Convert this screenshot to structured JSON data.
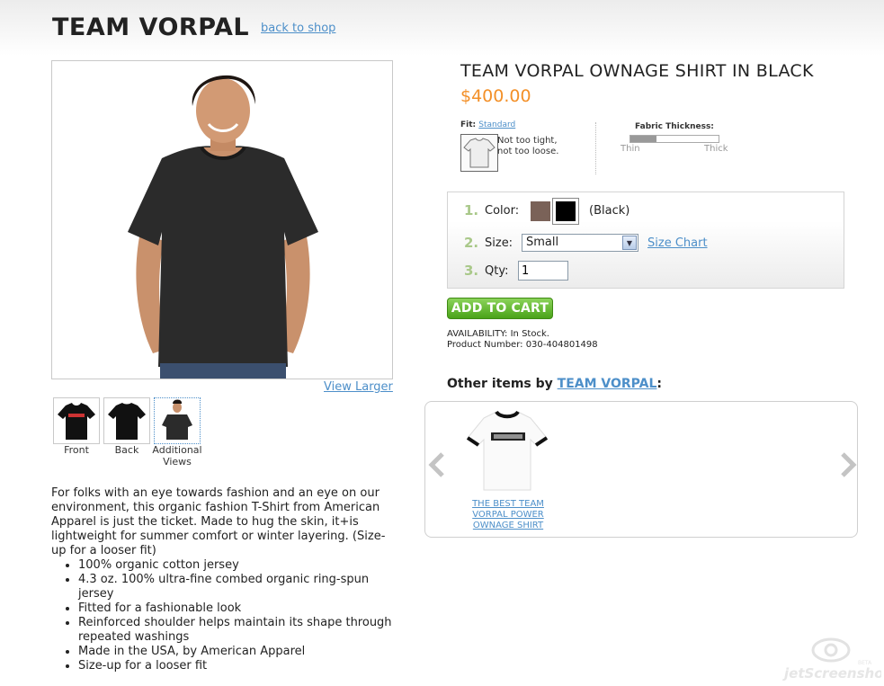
{
  "header": {
    "brand": "TEAM VORPAL",
    "back_link": "back to shop"
  },
  "gallery": {
    "view_larger": "View Larger",
    "thumbnails": [
      {
        "label": "Front"
      },
      {
        "label": "Back"
      },
      {
        "label": "Additional Views"
      }
    ]
  },
  "product": {
    "title": "TEAM VORPAL OWNAGE SHIRT IN BLACK",
    "price": "$400.00",
    "fit_label": "Fit:",
    "fit_value": "Standard",
    "fit_desc": "Not too tight, not too loose.",
    "thickness_label": "Fabric Thickness:",
    "thickness_level": 0.3,
    "thin_label": "Thin",
    "thick_label": "Thick"
  },
  "options": {
    "step1": "1.",
    "color_label": "Color:",
    "color_value": "(Black)",
    "swatches": [
      "#7a6258",
      "#000000"
    ],
    "step2": "2.",
    "size_label": "Size:",
    "size_selected": "Small",
    "size_chart": "Size Chart",
    "step3": "3.",
    "qty_label": "Qty:",
    "qty_value": "1"
  },
  "cart": {
    "add_label": "ADD TO CART",
    "availability": "AVAILABILITY: In Stock.",
    "product_number": "Product Number: 030-404801498"
  },
  "other_items": {
    "prefix": "Other items by",
    "brand_link": "TEAM VORPAL",
    "suffix": ":",
    "items": [
      {
        "label": "THE BEST TEAM VORPAL POWER OWNAGE SHIRT"
      }
    ]
  },
  "description": {
    "text": "For folks with an eye towards fashion and an eye on our environment, this organic fashion T-Shirt from American Apparel is just the ticket. Made to hug the skin, it+is lightweight for summer comfort or winter layering. (Size-up for a looser fit)",
    "bullets": [
      "100% organic cotton jersey",
      "4.3 oz. 100% ultra-fine combed organic ring-spun jersey",
      "Fitted for a fashionable look",
      "Reinforced shoulder helps maintain its shape through repeated washings",
      "Made in the USA, by American Apparel",
      "Size-up for a looser fit"
    ]
  },
  "watermark": {
    "brand": "jetScreenshot",
    "small": "BETA"
  }
}
